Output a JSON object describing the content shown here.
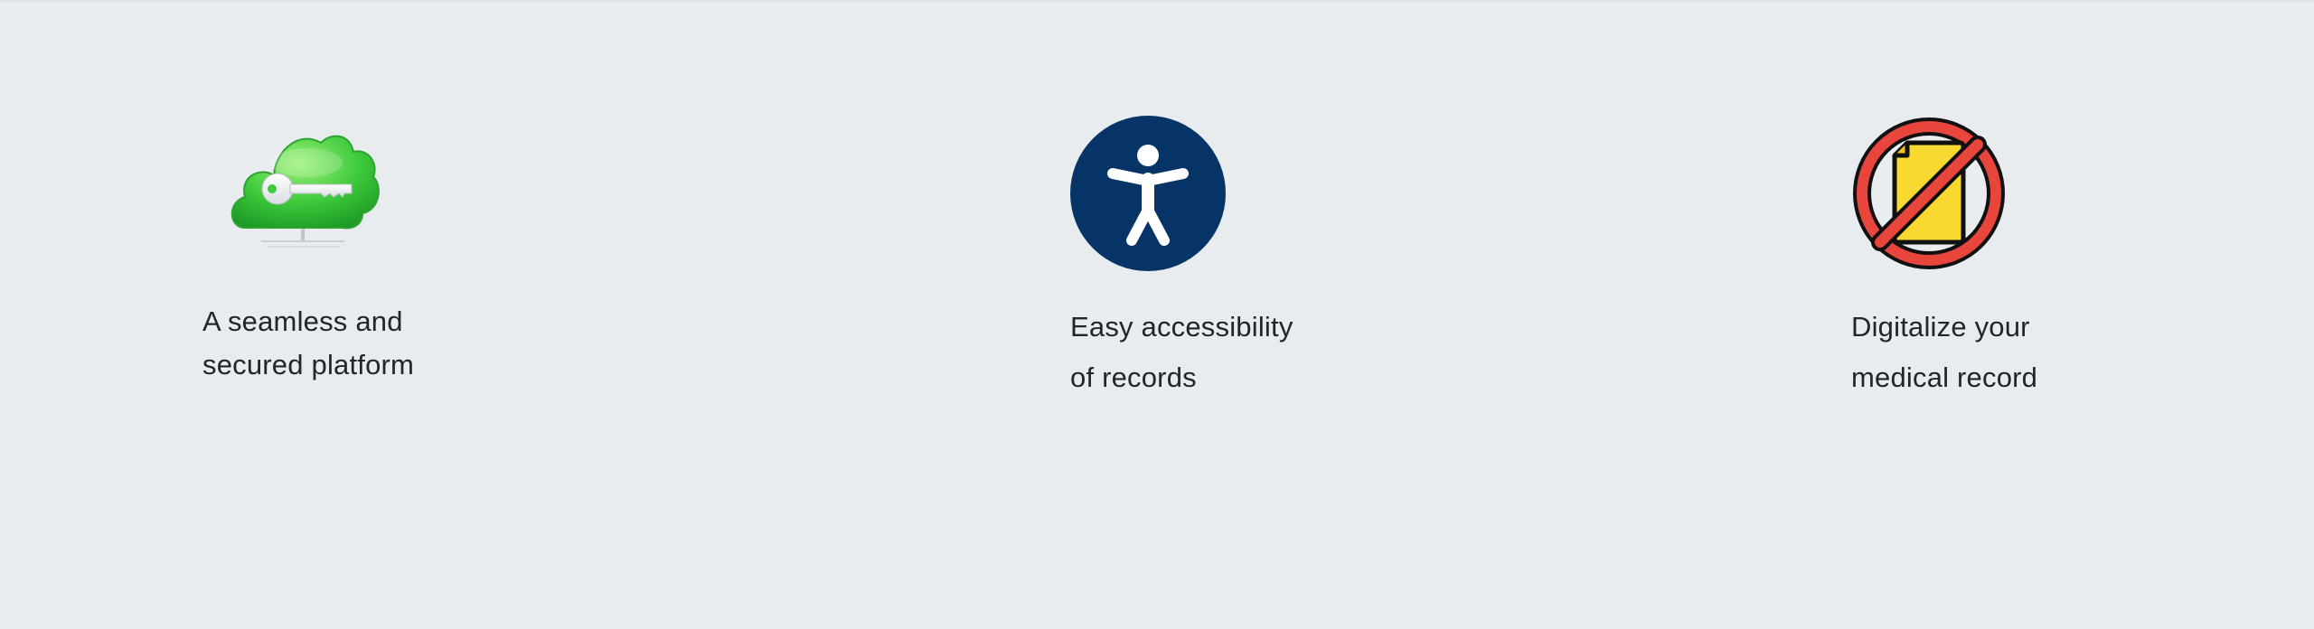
{
  "features": [
    {
      "icon": "cloud-key-icon",
      "line1": "A seamless and",
      "line2": "secured platform"
    },
    {
      "icon": "accessibility-icon",
      "line1": "Easy accessibility",
      "line2": "of records"
    },
    {
      "icon": "no-paper-document-icon",
      "line1": "Digitalize your",
      "line2": "medical record"
    }
  ],
  "colors": {
    "background": "#e8ecef",
    "cloud_green": "#3fcb3c",
    "accessibility_navy": "#063466",
    "prohibition_red": "#e8463d",
    "document_yellow": "#f8d92f"
  }
}
